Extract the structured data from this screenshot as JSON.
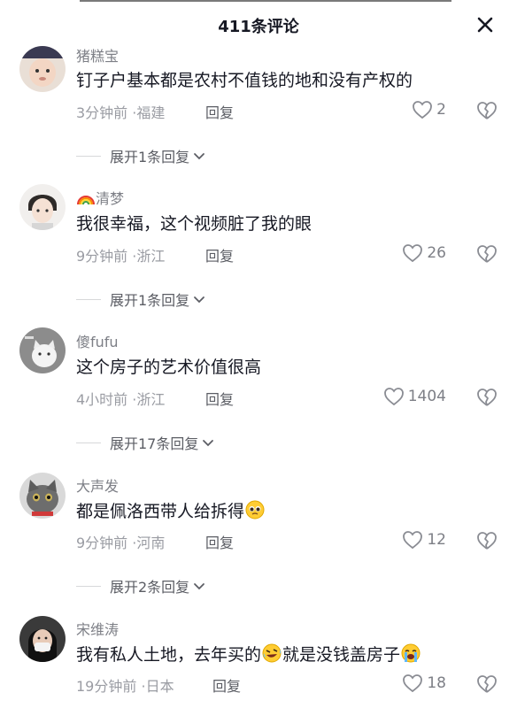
{
  "header": {
    "title": "411条评论"
  },
  "comments": [
    {
      "username": "猪糕宝",
      "text": "钉子户基本都是农村不值钱的地和没有产权的",
      "time": "3分钟前",
      "location": "福建",
      "reply_label": "回复",
      "likes": "2",
      "expand_label": "展开1条回复"
    },
    {
      "username": "清梦",
      "text": "我很幸福，这个视频脏了我的眼",
      "time": "9分钟前",
      "location": "浙江",
      "reply_label": "回复",
      "likes": "26",
      "expand_label": "展开1条回复"
    },
    {
      "username": "傻fufu",
      "text": "这个房子的艺术价值很高",
      "time": "4小时前",
      "location": "浙江",
      "reply_label": "回复",
      "likes": "1404",
      "expand_label": "展开17条回复"
    },
    {
      "username": "大声发",
      "text": "都是佩洛西带人给拆得",
      "time": "9分钟前",
      "location": "河南",
      "reply_label": "回复",
      "likes": "12",
      "expand_label": "展开2条回复"
    },
    {
      "username": "宋维涛",
      "text_part1": "我有私人土地，去年买的",
      "text_part2": "就是没钱盖房子",
      "time": "19分钟前",
      "location": "日本",
      "reply_label": "回复",
      "likes": "18"
    }
  ],
  "meta_separator": "·",
  "icons": {
    "close": "close-icon",
    "like": "heart-outline-icon",
    "dislike": "broken-heart-icon",
    "expand": "chevron-down-icon",
    "emoji_pleading": "pleading-face-emoji",
    "emoji_laughing": "rolling-laughing-emoji",
    "emoji_crying": "loudly-crying-emoji",
    "username_prefix": "rainbow-emoji"
  },
  "colors": {
    "text_primary": "#161823",
    "text_secondary": "#9a9ca3",
    "accent": "#161823"
  }
}
